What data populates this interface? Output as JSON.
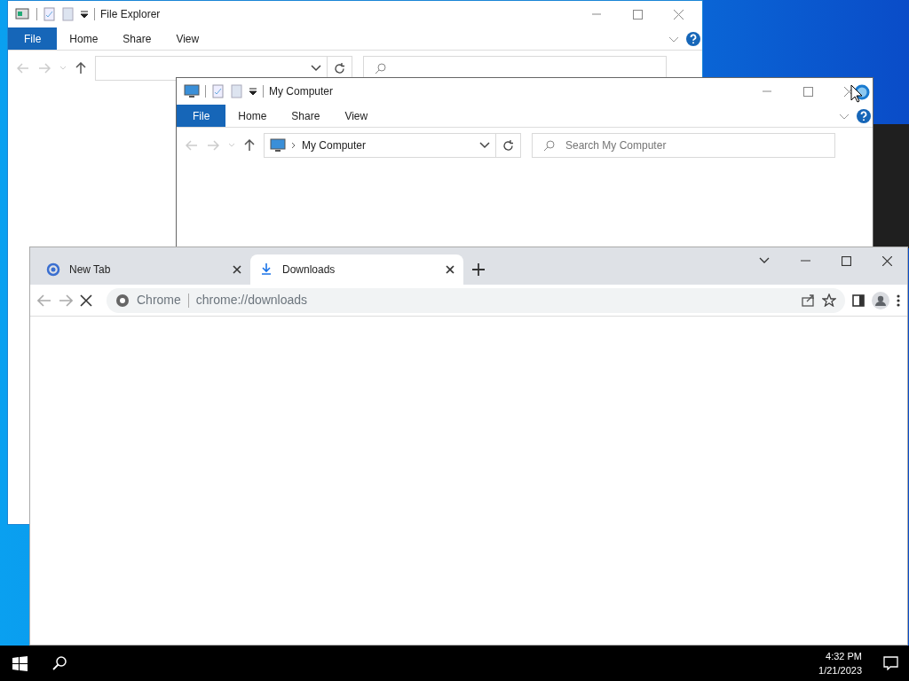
{
  "explorer_windows": [
    {
      "title": "File Explorer",
      "ribbon_tabs": [
        {
          "label": "File",
          "kind": "file"
        },
        {
          "label": "Home",
          "kind": "tab"
        },
        {
          "label": "Share",
          "kind": "tab"
        },
        {
          "label": "View",
          "kind": "tab"
        }
      ]
    },
    {
      "title": "My Computer",
      "ribbon_tabs": [
        {
          "label": "File",
          "kind": "file"
        },
        {
          "label": "Home",
          "kind": "tab"
        },
        {
          "label": "Share",
          "kind": "tab"
        },
        {
          "label": "View",
          "kind": "tab"
        }
      ],
      "address": "My Computer",
      "search_placeholder": "Search My Computer"
    }
  ],
  "chrome": {
    "tabs": [
      {
        "label": "New Tab",
        "selected": false
      },
      {
        "label": "Downloads",
        "selected": true
      }
    ],
    "loading": true,
    "site_chip": "Chrome",
    "url": "chrome://downloads"
  },
  "taskbar": {
    "time": "4:32 PM",
    "date": "1/21/2023"
  }
}
